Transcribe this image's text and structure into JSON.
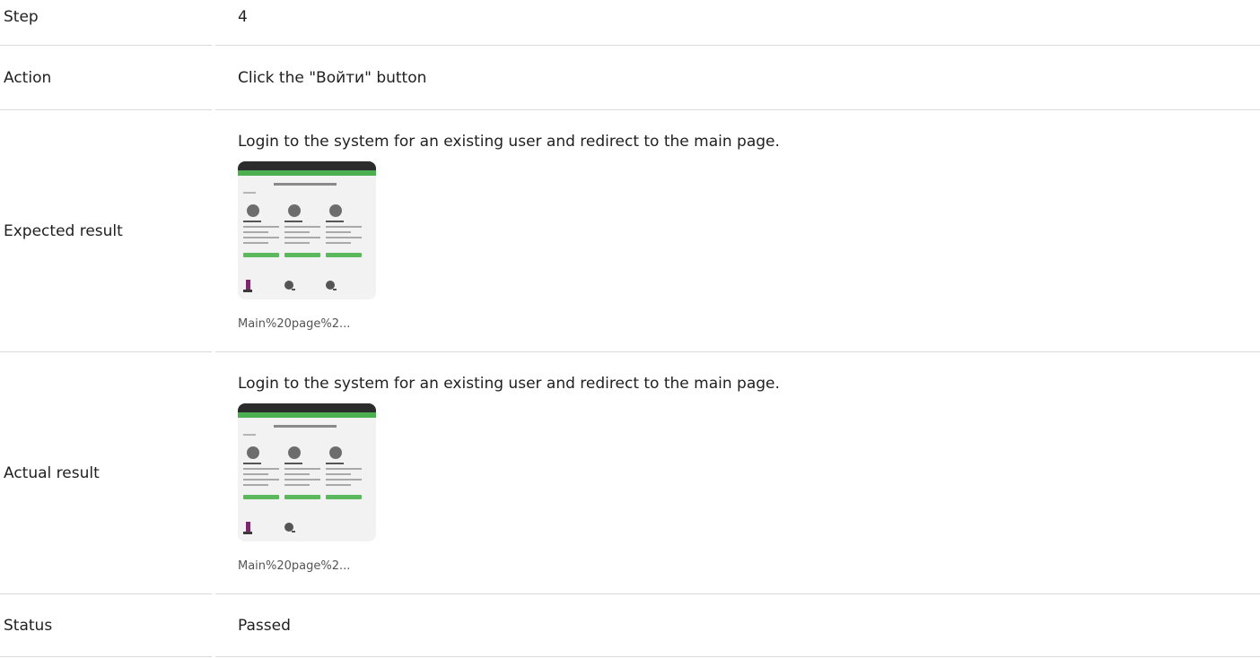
{
  "rows": {
    "step": {
      "label": "Step",
      "value": "4"
    },
    "action": {
      "label": "Action",
      "value": "Click the \"Войти\" button"
    },
    "expected": {
      "label": "Expected result",
      "text": "Login to the system for an existing user and redirect to the main page.",
      "attachment_caption": "Main%20page%2..."
    },
    "actual": {
      "label": "Actual result",
      "text": "Login to the system for an existing user and redirect to the main page.",
      "attachment_caption": "Main%20page%2..."
    },
    "status": {
      "label": "Status",
      "value": "Passed"
    }
  },
  "colors": {
    "separator": "#d9d9d9",
    "thumb_topbar": "#2c2c2c",
    "thumb_accent": "#4caf50"
  }
}
